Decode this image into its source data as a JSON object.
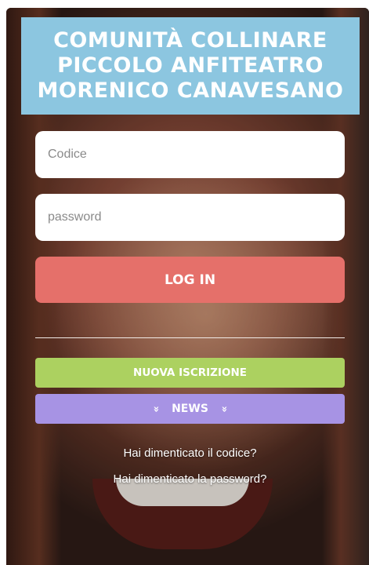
{
  "header": {
    "line1": "COMUNITÀ COLLINARE",
    "line2": "PICCOLO ANFITEATRO",
    "line3": "MORENICO CANAVESANO"
  },
  "form": {
    "code_placeholder": "Codice",
    "password_placeholder": "password",
    "login_label": "LOG IN"
  },
  "actions": {
    "new_registration_label": "NUOVA ISCRIZIONE",
    "news_label": "NEWS",
    "news_icon": "double-chevron-down-icon"
  },
  "links": {
    "forgot_code": "Hai dimenticato il codice?",
    "forgot_password": "Hai dimenticato la password?"
  },
  "colors": {
    "header_bg": "#8cc6e0",
    "login_bg": "#e5706a",
    "registration_bg": "#acd160",
    "news_bg": "#a793e4"
  }
}
